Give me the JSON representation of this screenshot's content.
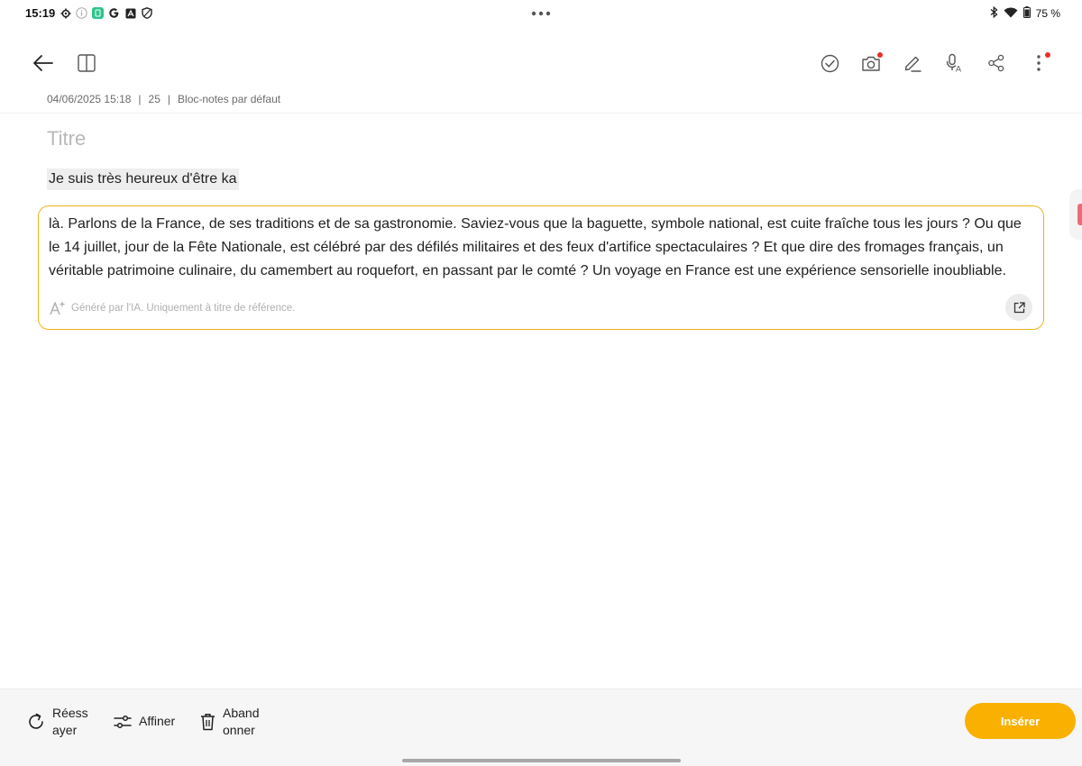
{
  "status_bar": {
    "time": "15:19",
    "battery": "75 %",
    "left_icons": [
      "gear-icon",
      "info-icon",
      "app-green-icon",
      "google-icon",
      "autofill-icon",
      "shield-icon"
    ],
    "right_icons": [
      "bluetooth-icon",
      "wifi-icon",
      "battery-icon"
    ]
  },
  "toolbar": {
    "left": [
      "back-arrow-icon",
      "split-view-icon"
    ],
    "right": [
      "ai-format-icon",
      "checklist-icon",
      "camera-icon",
      "pen-icon",
      "voice-icon",
      "share-icon",
      "more-icon"
    ]
  },
  "meta": {
    "date": "04/06/2025 15:18",
    "count": "25",
    "notebook": "Bloc-notes par défaut"
  },
  "note": {
    "title_placeholder": "Titre",
    "selected_text": "Je suis très heureux d'être ka"
  },
  "ai_result": {
    "text": "là.  Parlons de la France, de ses traditions et de sa gastronomie.  Saviez-vous que la baguette, symbole national, est cuite fraîche tous les jours ?  Ou que le 14 juillet, jour de la Fête Nationale, est célébré par des défilés militaires et des feux d'artifice spectaculaires ?  Et que dire des fromages français, un véritable patrimoine culinaire, du camembert au roquefort, en passant par le comté ?  Un voyage en France est une expérience sensorielle inoubliable.",
    "disclaimer": "Généré par l'IA. Uniquement à titre de référence."
  },
  "actions": {
    "retry_line1": "Réess",
    "retry_line2": "ayer",
    "refine": "Affiner",
    "discard_line1": "Aband",
    "discard_line2": "onner",
    "insert": "Insérer"
  },
  "colors": {
    "accent": "#f9b000",
    "ai_border": "#f0b21a",
    "notification_dot": "#e8302a"
  }
}
